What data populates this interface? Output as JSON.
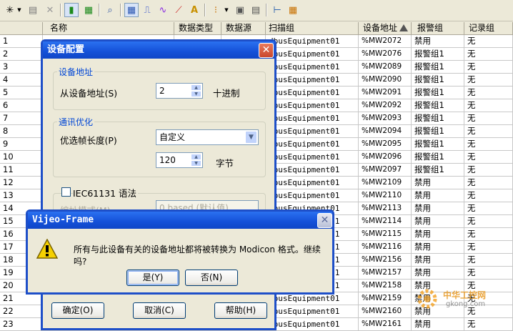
{
  "toolbar": {
    "items": [
      "sparkle-icon",
      "dropdown-arrow-icon",
      "import-icon",
      "delete-icon",
      "view-green-icon",
      "view-tile-icon",
      "zoom-icon",
      "grid-view-icon",
      "pulse-icon",
      "wave-icon",
      "trend-icon",
      "text-a-icon",
      "color-icon",
      "dropdown-arrow-icon",
      "window-icon",
      "table-icon",
      "tree-icon",
      "sheet-icon"
    ]
  },
  "grid": {
    "headers": {
      "name": "名称",
      "data_type": "数据类型",
      "data_source": "数据源",
      "scan_group": "扫描组",
      "device_address": "设备地址",
      "alarm_group": "报警组",
      "log_group": "记录组"
    },
    "rows": [
      {
        "no": "1",
        "scan": "dbusEquipment01",
        "addr": "%MW2072",
        "alarm": "禁用",
        "log": "无"
      },
      {
        "no": "2",
        "scan": "dbusEquipment01",
        "addr": "%MW2076",
        "alarm": "报警组1",
        "log": "无"
      },
      {
        "no": "3",
        "scan": "dbusEquipment01",
        "addr": "%MW2089",
        "alarm": "报警组1",
        "log": "无"
      },
      {
        "no": "4",
        "scan": "dbusEquipment01",
        "addr": "%MW2090",
        "alarm": "报警组1",
        "log": "无"
      },
      {
        "no": "5",
        "scan": "dbusEquipment01",
        "addr": "%MW2091",
        "alarm": "报警组1",
        "log": "无"
      },
      {
        "no": "6",
        "scan": "dbusEquipment01",
        "addr": "%MW2092",
        "alarm": "报警组1",
        "log": "无"
      },
      {
        "no": "7",
        "scan": "dbusEquipment01",
        "addr": "%MW2093",
        "alarm": "报警组1",
        "log": "无"
      },
      {
        "no": "8",
        "scan": "dbusEquipment01",
        "addr": "%MW2094",
        "alarm": "报警组1",
        "log": "无"
      },
      {
        "no": "9",
        "scan": "dbusEquipment01",
        "addr": "%MW2095",
        "alarm": "报警组1",
        "log": "无"
      },
      {
        "no": "10",
        "scan": "dbusEquipment01",
        "addr": "%MW2096",
        "alarm": "报警组1",
        "log": "无"
      },
      {
        "no": "11",
        "scan": "dbusEquipment01",
        "addr": "%MW2097",
        "alarm": "报警组1",
        "log": "无"
      },
      {
        "no": "12",
        "scan": "dbusEquipment01",
        "addr": "%MW2109",
        "alarm": "禁用",
        "log": "无"
      },
      {
        "no": "13",
        "scan": "dbusEquipment01",
        "addr": "%MW2110",
        "alarm": "禁用",
        "log": "无"
      },
      {
        "no": "14",
        "scan": "dbusEquipment01",
        "addr": "%MW2113",
        "alarm": "禁用",
        "log": "无"
      },
      {
        "no": "15",
        "scan": "dbusEquipment01",
        "addr": "%MW2114",
        "alarm": "禁用",
        "log": "无"
      },
      {
        "no": "16",
        "scan": "dbusEquipment01",
        "addr": "%MW2115",
        "alarm": "禁用",
        "log": "无"
      },
      {
        "no": "17",
        "scan": "dbusEquipment01",
        "addr": "%MW2116",
        "alarm": "禁用",
        "log": "无"
      },
      {
        "no": "18",
        "scan": "dbusEquipment01",
        "addr": "%MW2156",
        "alarm": "禁用",
        "log": "无"
      },
      {
        "no": "19",
        "scan": "dbusEquipment01",
        "addr": "%MW2157",
        "alarm": "禁用",
        "log": "无"
      },
      {
        "no": "20",
        "scan": "dbusEquipment01",
        "addr": "%MW2158",
        "alarm": "禁用",
        "log": "无"
      },
      {
        "no": "21",
        "scan": "dbusEquipment01",
        "addr": "%MW2159",
        "alarm": "禁用",
        "log": "无"
      },
      {
        "no": "22",
        "scan": "dbusEquipment01",
        "addr": "%MW2160",
        "alarm": "禁用",
        "log": "无"
      },
      {
        "no": "23",
        "scan": "dbusEquipment01",
        "addr": "%MW2161",
        "alarm": "禁用",
        "log": "无"
      }
    ]
  },
  "config_dialog": {
    "title": "设备配置",
    "close": "✕",
    "address_group": "设备地址",
    "from_address_label": "从设备地址(S)",
    "from_address_value": "2",
    "decimal": "十进制",
    "comm_group": "通讯优化",
    "frame_length_label": "优选帧长度(P)",
    "frame_length_value": "自定义",
    "frame_size_value": "120",
    "bytes": "字节",
    "iec_label": "IEC61131 语法",
    "addr_mode_label": "编址模式(M)",
    "addr_mode_value": "0 based (默认值)",
    "ok": "确定(O)",
    "cancel": "取消(C)",
    "help": "帮助(H)"
  },
  "message_box": {
    "title": "Vijeo-Frame",
    "text": "所有与此设备有关的设备地址都将被转换为 Modicon 格式。继续吗?",
    "yes": "是(Y)",
    "no": "否(N)",
    "close": "✕"
  },
  "watermark": {
    "line1": "中华工控网",
    "line2": "gkong.com"
  }
}
